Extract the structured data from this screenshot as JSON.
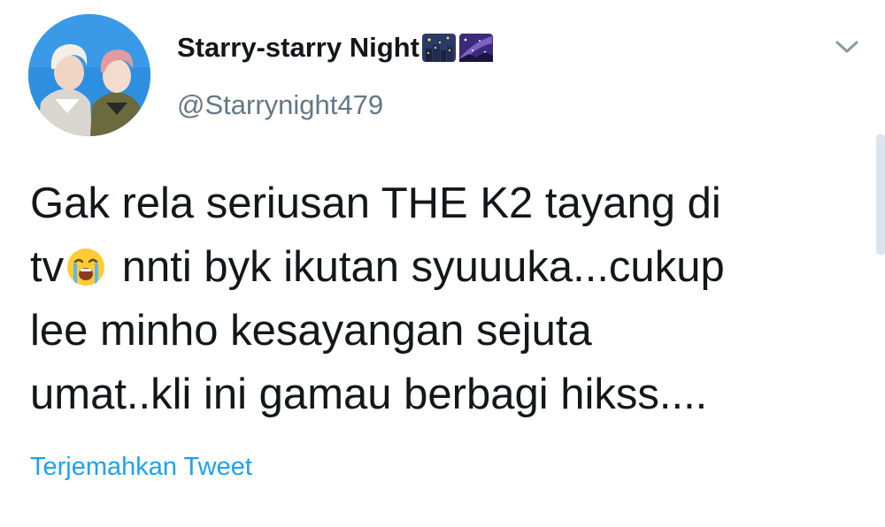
{
  "user": {
    "display_name": "Starry-starry Night",
    "name_emojis": [
      "night-with-stars-emoji",
      "milky-way-emoji"
    ],
    "handle": "@Starrynight479",
    "avatar": "profile-photo"
  },
  "menu": {
    "icon": "chevron-down-icon"
  },
  "tweet": {
    "line1": "Gak rela seriusan THE K2 tayang di",
    "line2_start": "tv",
    "line2_emoji": "loudly-crying-face-emoji",
    "line2_end": " nnti byk ikutan syuuuka...cukup",
    "line3": "lee minho kesayangan sejuta",
    "line4": "umat..kli ini gamau berbagi hikss...."
  },
  "translate": {
    "label": "Terjemahkan Tweet"
  },
  "colors": {
    "text": "#14171a",
    "secondary": "#657786",
    "link": "#1da1f2"
  }
}
